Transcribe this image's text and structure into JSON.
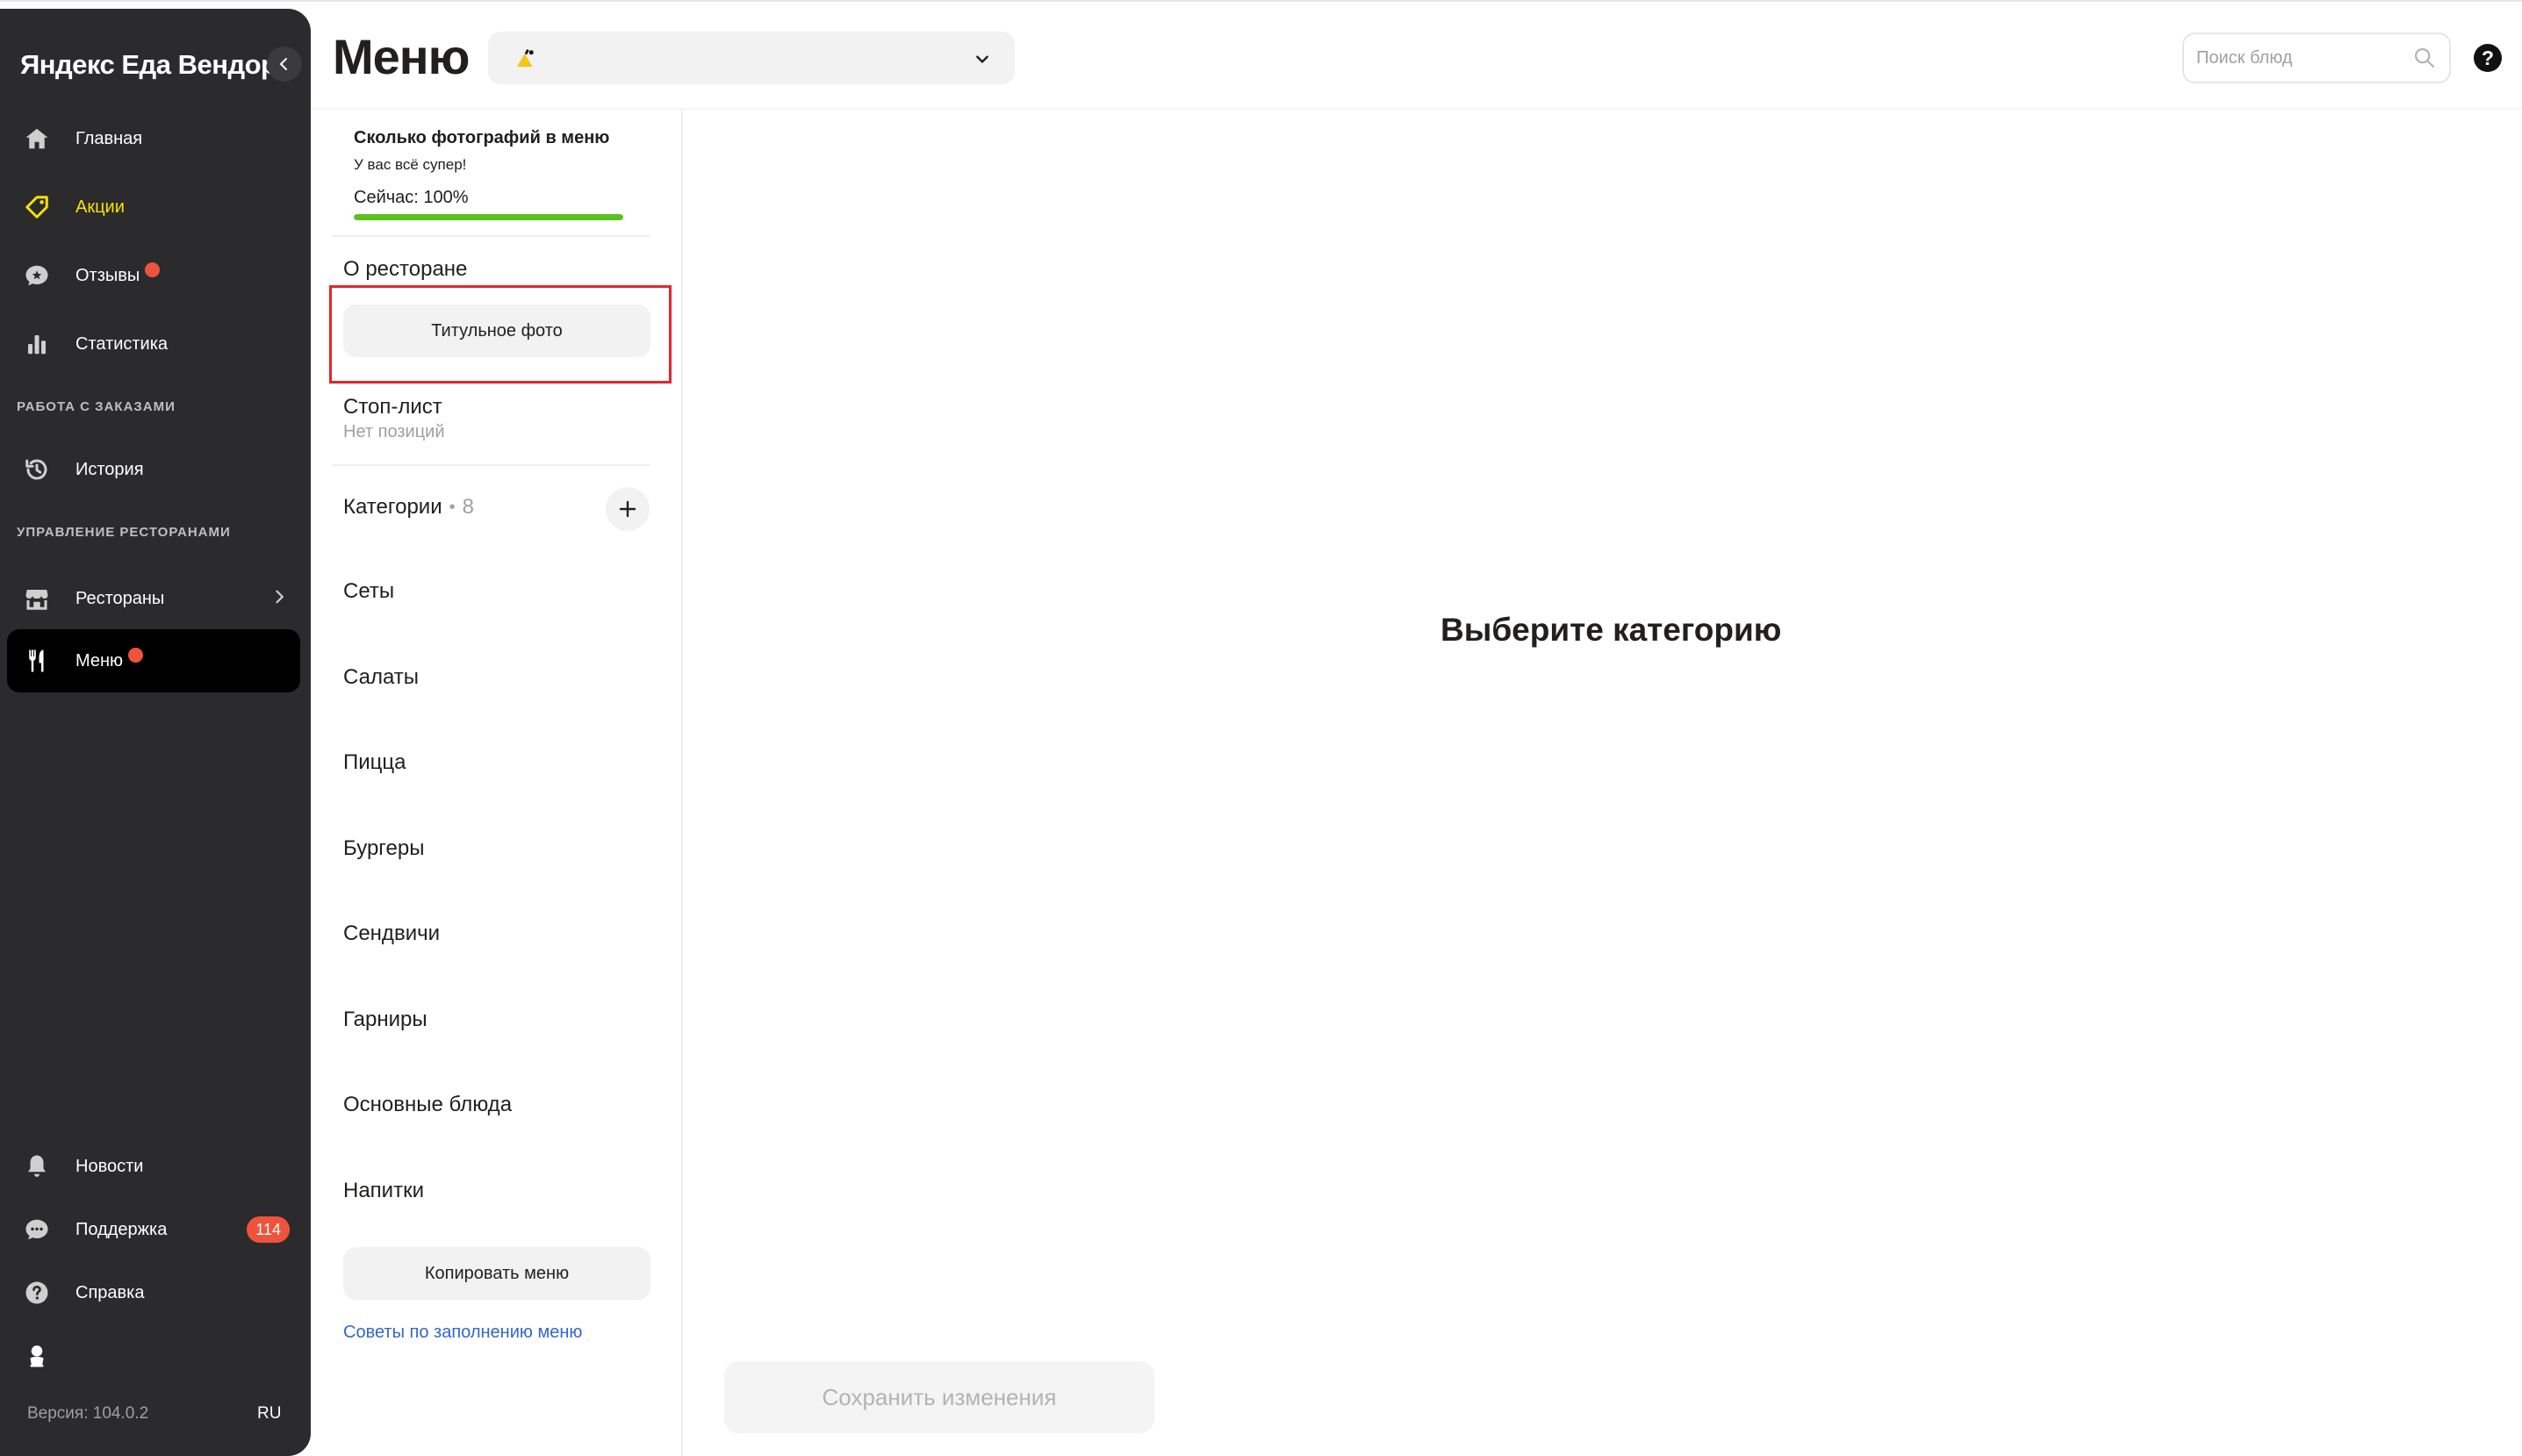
{
  "sidebar": {
    "brand": "Яндекс Еда Вендор",
    "items": [
      {
        "label": "Главная",
        "icon": "home-icon"
      },
      {
        "label": "Акции",
        "icon": "tag-icon",
        "color": "#fce000"
      },
      {
        "label": "Отзывы",
        "icon": "chat-star-icon",
        "has_dot": true
      },
      {
        "label": "Статистика",
        "icon": "bar-chart-icon"
      }
    ],
    "section_orders": "РАБОТА С ЗАКАЗАМИ",
    "orders_items": [
      {
        "label": "История",
        "icon": "history-icon"
      }
    ],
    "section_restaurants": "УПРАВЛЕНИЕ РЕСТОРАНАМИ",
    "restaurant_items": [
      {
        "label": "Рестораны",
        "icon": "store-icon"
      },
      {
        "label": "Меню",
        "icon": "fork-knife-icon",
        "active": true,
        "has_dot": true
      }
    ],
    "bottom_items": [
      {
        "label": "Новости",
        "icon": "bell-icon"
      },
      {
        "label": "Поддержка",
        "icon": "support-chat-icon",
        "badge": "114"
      },
      {
        "label": "Справка",
        "icon": "question-icon"
      }
    ],
    "version": "Версия: 104.0.2",
    "lang": "RU"
  },
  "header": {
    "title": "Меню",
    "search_placeholder": "Поиск блюд",
    "help": "?"
  },
  "left_panel": {
    "photos_title": "Сколько фотографий в меню",
    "photos_subtitle": "У вас всё супер!",
    "photos_now": "Сейчас: 100%",
    "photos_progress": 1.0,
    "about_title": "О ресторане",
    "title_photo_button": "Титульное фото",
    "stop_list_title": "Стоп-лист",
    "stop_list_sub": "Нет позиций",
    "categories_title": "Категории",
    "categories_count": "8",
    "categories": [
      "Сеты",
      "Салаты",
      "Пицца",
      "Бургеры",
      "Сендвичи",
      "Гарниры",
      "Основные блюда",
      "Напитки"
    ],
    "copy_menu_button": "Копировать меню",
    "tips_link": "Советы по заполнению меню"
  },
  "main": {
    "empty_title": "Выберите категорию",
    "save_button": "Сохранить изменения"
  },
  "colors": {
    "sidebar_bg": "#2b2b2e",
    "accent_yellow": "#fce000",
    "badge_red": "#f0533c",
    "progress_green": "#5ac31a",
    "link_blue": "#3366cc",
    "highlight_red": "#e3262c"
  }
}
